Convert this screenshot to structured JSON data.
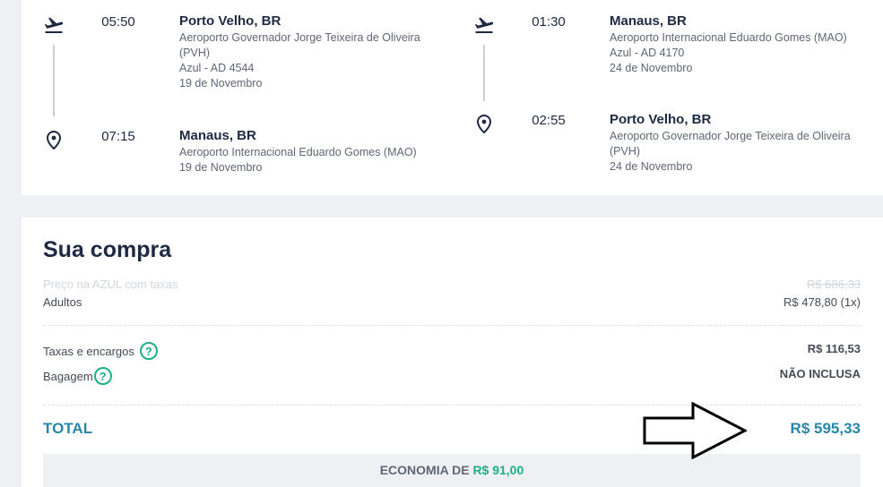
{
  "outbound": {
    "departure": {
      "time": "05:50",
      "city": "Porto Velho, BR",
      "airport": "Aeroporto Governador Jorge Teixeira de Oliveira (PVH)",
      "flight": "Azul - AD 4544",
      "date": "19 de Novembro",
      "icon": "plane-takeoff-icon"
    },
    "arrival": {
      "time": "07:15",
      "city": "Manaus, BR",
      "airport": "Aeroporto Internacional Eduardo Gomes (MAO)",
      "date": "19 de Novembro",
      "icon": "location-pin-icon"
    }
  },
  "inbound": {
    "departure": {
      "time": "01:30",
      "city": "Manaus, BR",
      "airport": "Aeroporto Internacional Eduardo Gomes (MAO)",
      "flight": "Azul - AD 4170",
      "date": "24 de Novembro",
      "icon": "plane-takeoff-icon"
    },
    "arrival": {
      "time": "02:55",
      "city": "Porto Velho, BR",
      "airport": "Aeroporto Governador Jorge Teixeira de Oliveira (PVH)",
      "date": "24 de Novembro",
      "icon": "location-pin-icon"
    }
  },
  "purchase": {
    "title": "Sua compra",
    "airline_price_label": "Preço na AZUL com taxas",
    "airline_price_value": "R$ 686,33",
    "adults_label": "Adultos",
    "adults_value": "R$ 478,80 (1x)",
    "taxes_label": "Taxas e encargos",
    "taxes_value": "R$ 116,53",
    "baggage_label": "Bagagem",
    "baggage_value": "NÃO INCLUSA",
    "help_icon_glyph": "?",
    "total_label": "TOTAL",
    "total_value": "R$ 595,33",
    "economy_label": "ECONOMIA DE",
    "economy_value": "R$ 91,00"
  },
  "colors": {
    "accent_teal": "#2a86a8",
    "accent_green": "#1fae8a",
    "text_dark": "#1e2a44"
  }
}
